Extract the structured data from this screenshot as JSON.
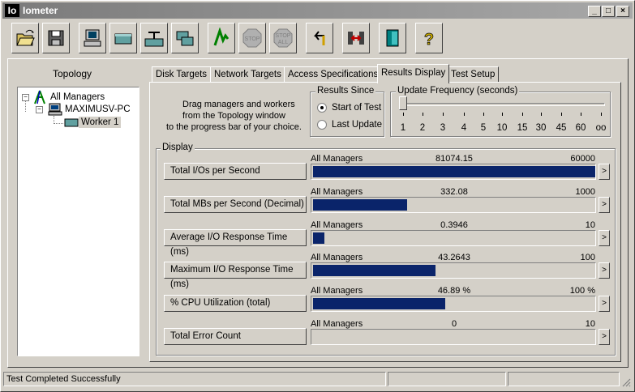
{
  "window": {
    "title": "Iometer",
    "app_icon": "Io"
  },
  "toolbar": [
    "open-config-icon",
    "save-config-icon",
    "start-worker-icon",
    "start-disk-worker-icon",
    "start-network-worker-icon",
    "duplicate-worker-icon",
    "start-tests-icon",
    "stop-icon",
    "stop-all-icon",
    "reset-workers-icon",
    "exit-icon",
    "exit-program-icon",
    "about-icon"
  ],
  "topology": {
    "title": "Topology",
    "root": "All Managers",
    "manager": "MAXIMUSV-PC",
    "worker": "Worker 1"
  },
  "tabs": [
    "Disk Targets",
    "Network Targets",
    "Access Specifications",
    "Results Display",
    "Test Setup"
  ],
  "active_tab": "Results Display",
  "instructions": [
    "Drag managers and workers",
    "from the Topology window",
    "to the progress bar of your choice."
  ],
  "results_since": {
    "title": "Results Since",
    "option1": "Start of Test",
    "option2": "Last Update",
    "selected": "Start of Test"
  },
  "update_frequency": {
    "title": "Update Frequency (seconds)",
    "ticks": [
      "1",
      "2",
      "3",
      "4",
      "5",
      "10",
      "15",
      "30",
      "45",
      "60",
      "oo"
    ],
    "value": "1"
  },
  "display": {
    "title": "Display",
    "rows": [
      {
        "button": "Total I/Os per Second",
        "source": "All Managers",
        "value": "81074.15",
        "max": "60000",
        "fill": 1.0
      },
      {
        "button": "Total MBs per Second (Decimal)",
        "source": "All Managers",
        "value": "332.08",
        "max": "1000",
        "fill": 0.332
      },
      {
        "button": "Average I/O Response Time (ms)",
        "source": "All Managers",
        "value": "0.3946",
        "max": "10",
        "fill": 0.0395
      },
      {
        "button": "Maximum I/O Response Time (ms)",
        "source": "All Managers",
        "value": "43.2643",
        "max": "100",
        "fill": 0.4326
      },
      {
        "button": "% CPU Utilization (total)",
        "source": "All Managers",
        "value": "46.89 %",
        "max": "100 %",
        "fill": 0.4689
      },
      {
        "button": "Total Error Count",
        "source": "All Managers",
        "value": "0",
        "max": "10",
        "fill": 0
      }
    ],
    "more_label": ">"
  },
  "status": {
    "text": "Test Completed Successfully"
  },
  "colors": {
    "bar": "#0a246a",
    "face": "#d4d0c8",
    "title_bar": "#808080"
  }
}
